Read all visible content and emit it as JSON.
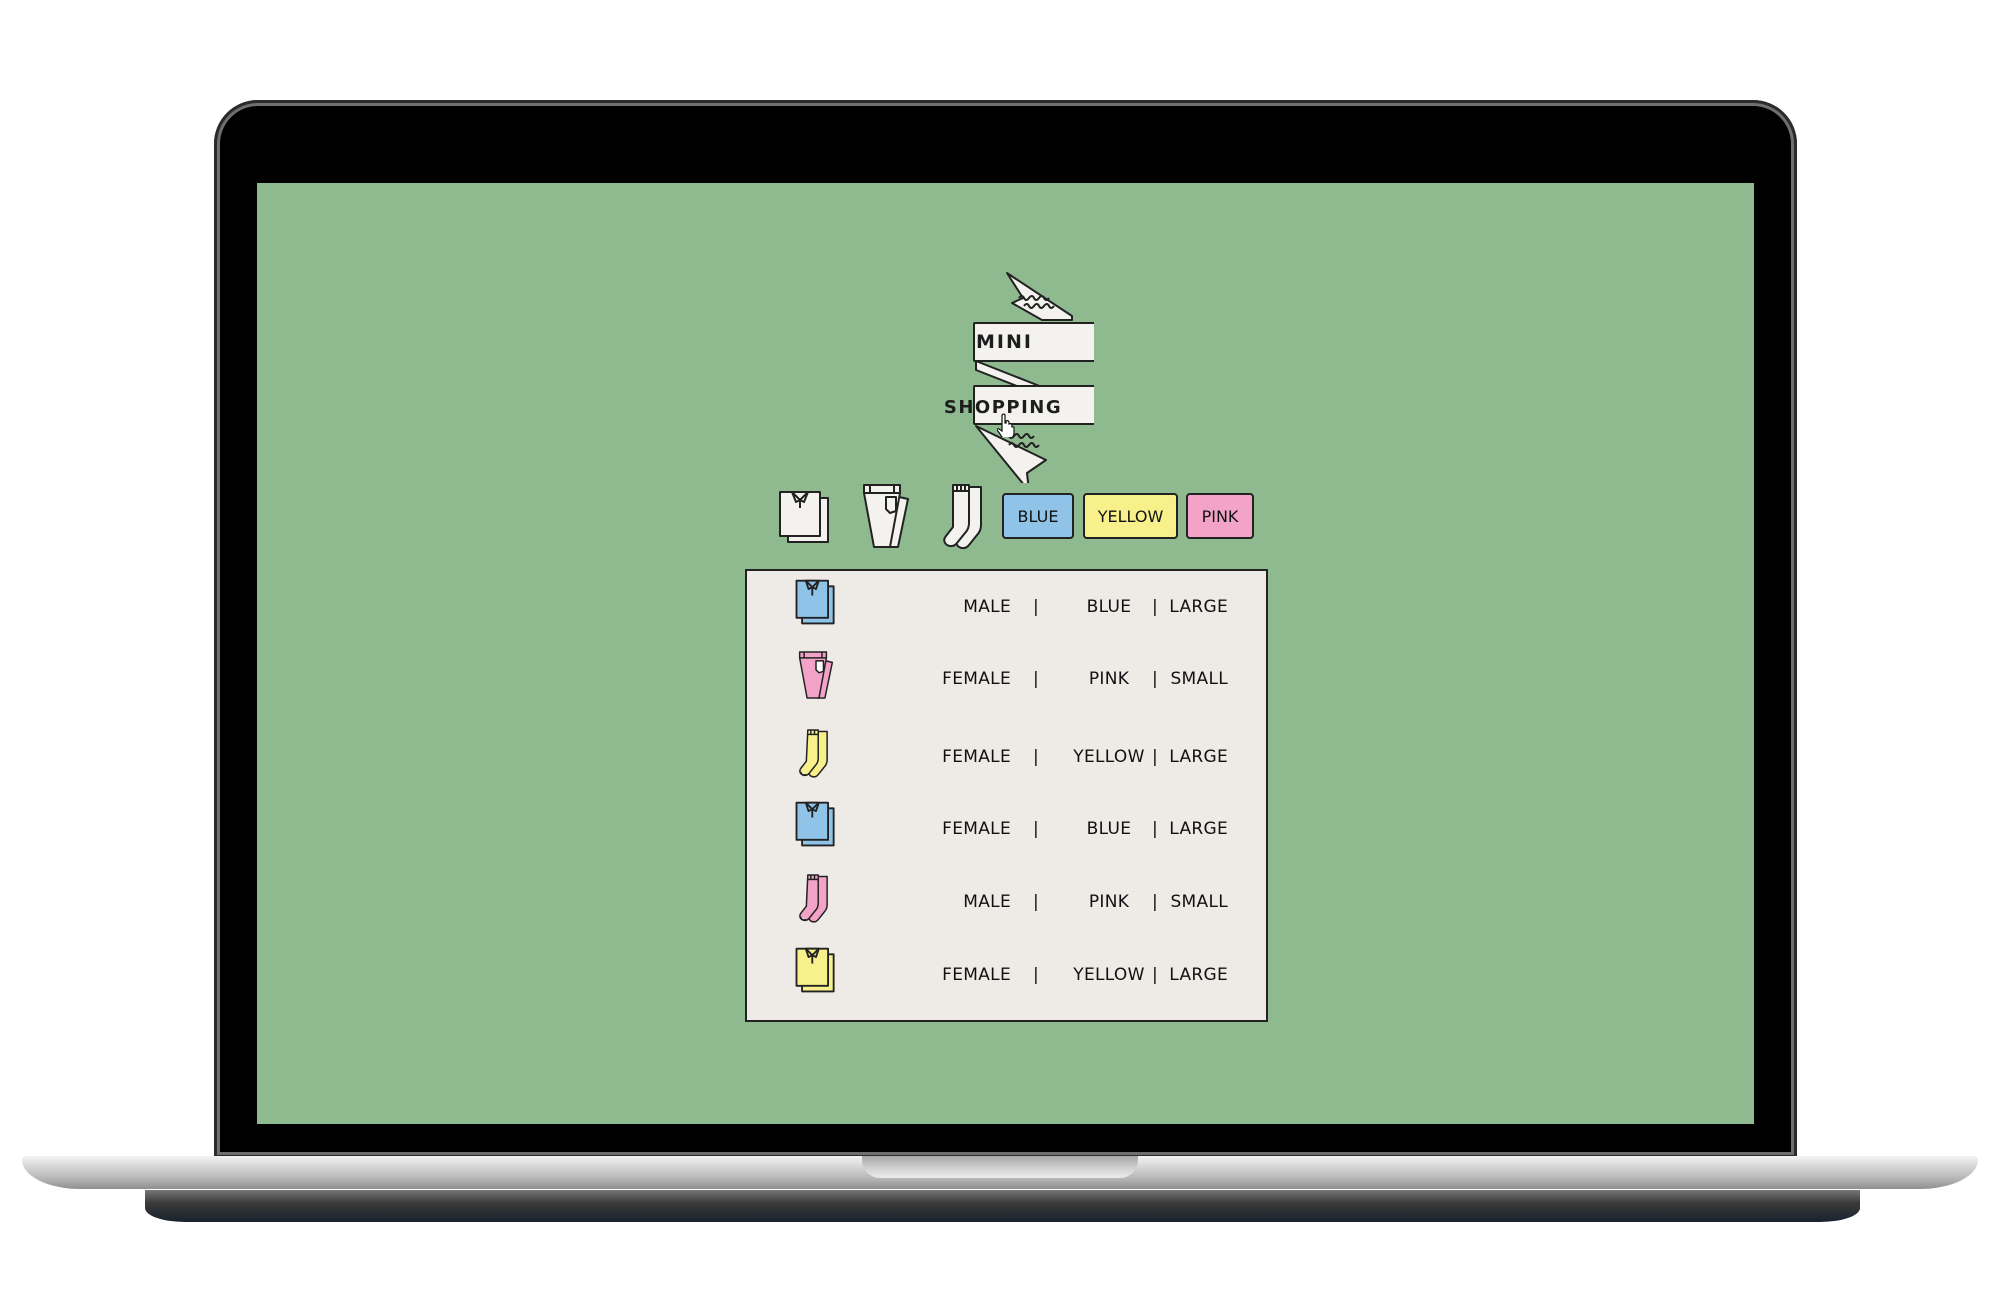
{
  "logo": {
    "line1": "MINI",
    "line2": "SHOPPING"
  },
  "categories": [
    {
      "name": "shirt",
      "icon": "shirt-icon"
    },
    {
      "name": "pants",
      "icon": "pants-icon"
    },
    {
      "name": "socks",
      "icon": "socks-icon"
    }
  ],
  "color_filters": [
    {
      "label": "BLUE",
      "color": "#8fc3e8"
    },
    {
      "label": "YELLOW",
      "color": "#f8f08a"
    },
    {
      "label": "PINK",
      "color": "#f4a3c8"
    }
  ],
  "separator": "|",
  "items": [
    {
      "type": "shirt",
      "icon": "shirt-icon",
      "fill": "#8fc3e8",
      "gender": "MALE",
      "color": "BLUE",
      "size": "LARGE"
    },
    {
      "type": "pants",
      "icon": "pants-icon",
      "fill": "#f4a3c8",
      "gender": "FEMALE",
      "color": "PINK",
      "size": "SMALL"
    },
    {
      "type": "socks",
      "icon": "socks-icon",
      "fill": "#f8f08a",
      "gender": "FEMALE",
      "color": "YELLOW",
      "size": "LARGE"
    },
    {
      "type": "shirt",
      "icon": "shirt-icon",
      "fill": "#8fc3e8",
      "gender": "FEMALE",
      "color": "BLUE",
      "size": "LARGE"
    },
    {
      "type": "socks",
      "icon": "socks-icon",
      "fill": "#f4a3c8",
      "gender": "MALE",
      "color": "PINK",
      "size": "SMALL"
    },
    {
      "type": "shirt",
      "icon": "shirt-icon",
      "fill": "#f8f08a",
      "gender": "FEMALE",
      "color": "YELLOW",
      "size": "LARGE"
    }
  ],
  "colors": {
    "screen_bg": "#8fba90",
    "panel_bg": "#eeeae6",
    "icon_white": "#f4f2ef"
  }
}
